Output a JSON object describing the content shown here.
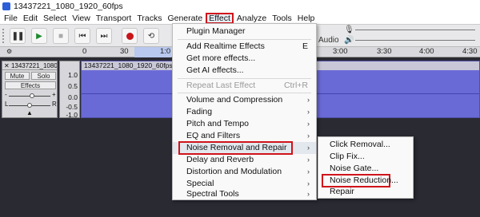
{
  "window": {
    "title": "13437221_1080_1920_60fps"
  },
  "menubar": {
    "items": [
      "File",
      "Edit",
      "Select",
      "View",
      "Transport",
      "Tracks",
      "Generate",
      "Effect",
      "Analyze",
      "Tools",
      "Help"
    ]
  },
  "toolbar": {
    "audio_label": "Audio"
  },
  "ruler": {
    "ticks": [
      "0",
      "30",
      "1:0",
      "3:00",
      "3:30",
      "4:00",
      "4:30"
    ]
  },
  "track": {
    "header_title": "13437221_1080_",
    "mute": "Mute",
    "solo": "Solo",
    "effects": "Effects",
    "pan_left": "L",
    "pan_right": "R",
    "gain_minus": "-",
    "gain_plus": "+",
    "scale": [
      "1.0",
      "0.5",
      "0.0",
      "-0.5",
      "-1.0"
    ],
    "clip_title": "13437221_1080_1920_60fps"
  },
  "effect_menu": {
    "items": [
      {
        "label": "Plugin Manager",
        "shortcut": ""
      },
      {
        "label": "Add Realtime Effects",
        "shortcut": "E"
      },
      {
        "label": "Get more effects...",
        "shortcut": ""
      },
      {
        "label": "Get AI effects...",
        "shortcut": ""
      },
      {
        "label": "Repeat Last Effect",
        "shortcut": "Ctrl+R"
      },
      {
        "label": "Volume and Compression",
        "shortcut": ""
      },
      {
        "label": "Fading",
        "shortcut": ""
      },
      {
        "label": "Pitch and Tempo",
        "shortcut": ""
      },
      {
        "label": "EQ and Filters",
        "shortcut": ""
      },
      {
        "label": "Noise Removal and Repair",
        "shortcut": ""
      },
      {
        "label": "Delay and Reverb",
        "shortcut": ""
      },
      {
        "label": "Distortion and Modulation",
        "shortcut": ""
      },
      {
        "label": "Special",
        "shortcut": ""
      },
      {
        "label": "Spectral Tools",
        "shortcut": ""
      }
    ]
  },
  "noise_submenu": {
    "items": [
      "Click Removal...",
      "Clip Fix...",
      "Noise Gate...",
      "Noise Reduction...",
      "Repair"
    ]
  },
  "icons": {
    "submenu_arrow": "chevron-right-icon"
  },
  "colors": {
    "highlight_outline": "#d0141b",
    "waveform": "#6a6ad6"
  }
}
